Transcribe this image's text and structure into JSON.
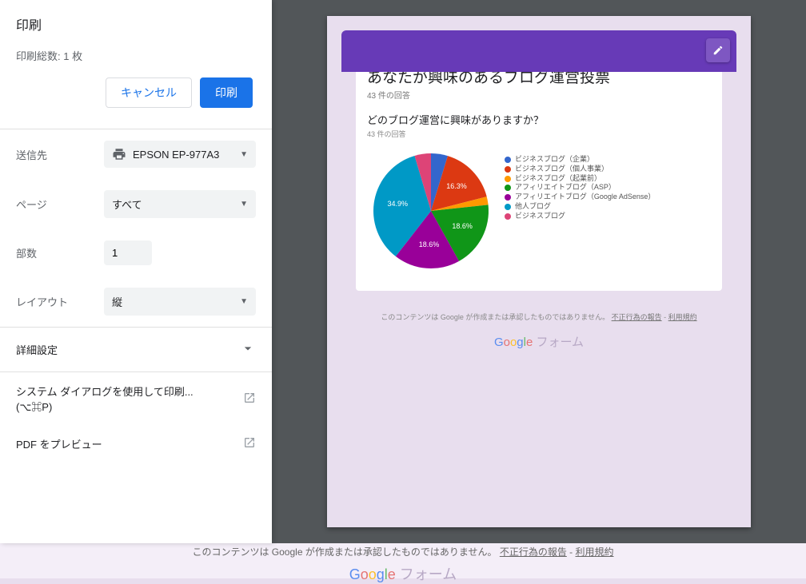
{
  "print": {
    "title": "印刷",
    "total": "印刷総数: 1 枚",
    "cancel": "キャンセル",
    "do_print": "印刷",
    "dest_label": "送信先",
    "dest_value": "EPSON EP-977A3",
    "pages_label": "ページ",
    "pages_value": "すべて",
    "copies_label": "部数",
    "copies_value": "1",
    "layout_label": "レイアウト",
    "layout_value": "縦",
    "advanced": "詳細設定",
    "system_dialog": "システム ダイアログを使用して印刷... (⌥⌘P)",
    "pdf_preview": "PDF をプレビュー"
  },
  "form": {
    "title": "あなたが興味のあるブログ運営投票",
    "responses": "43 件の回答",
    "question": "どのブログ運営に興味がありますか？",
    "q_responses": "43 件の回答",
    "footer_text": "このコンテンツは Google が作成または承認したものではありません。",
    "footer_link1": "不正行為の報告",
    "footer_sep": " - ",
    "footer_link2": "利用規約",
    "google": "Google",
    "forms": " フォーム"
  },
  "chart_data": {
    "type": "pie",
    "title": "どのブログ運営に興味がありますか？",
    "series": [
      {
        "name": "ビジネスブログ（企業）",
        "value": 4.7,
        "color": "#3366cc"
      },
      {
        "name": "ビジネスブログ（個人事業）",
        "value": 16.3,
        "color": "#dc3912"
      },
      {
        "name": "ビジネスブログ（起業前）",
        "value": 2.3,
        "color": "#ff9900"
      },
      {
        "name": "アフィリエイトブログ（ASP）",
        "value": 18.6,
        "color": "#109618"
      },
      {
        "name": "アフィリエイトブログ（Google AdSense）",
        "value": 18.6,
        "color": "#990099"
      },
      {
        "name": "他人ブログ",
        "value": 34.9,
        "color": "#0099c6"
      },
      {
        "name": "ビジネスブログ",
        "value": 4.6,
        "color": "#dd4477"
      }
    ],
    "visible_labels": [
      "34.9%",
      "18.6%",
      "18.6%",
      "16.3%"
    ]
  },
  "bottom": {
    "text": "このコンテンツは Google が作成または承認したものではありません。",
    "link1": "不正行為の報告",
    "sep": " - ",
    "link2": "利用規約"
  }
}
